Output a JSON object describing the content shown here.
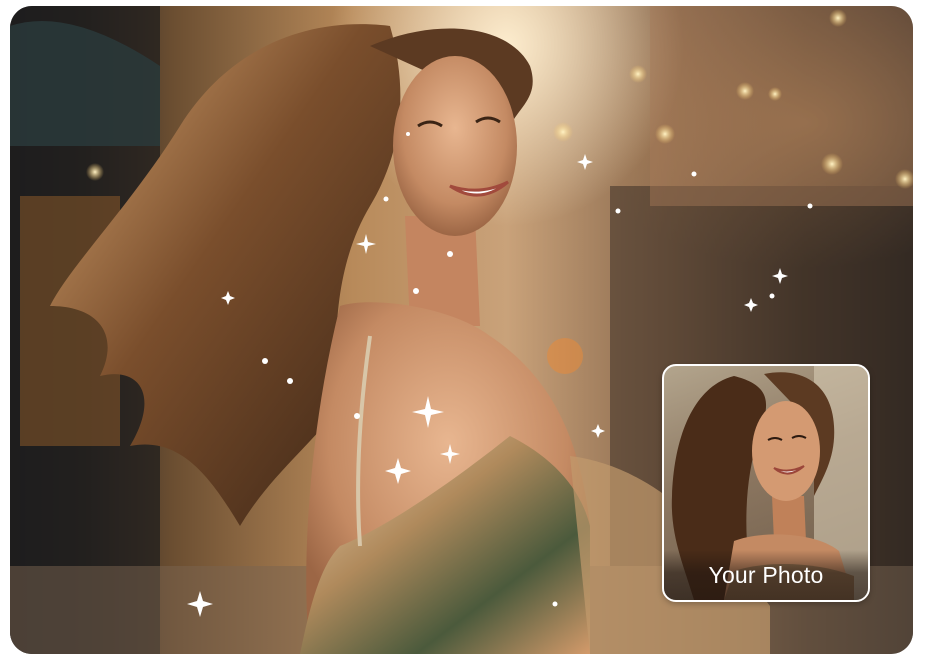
{
  "hero": {
    "image_name": "smiling-woman-sparkles-photo"
  },
  "thumbnail": {
    "caption": "Your Photo",
    "border_color": "#ffffff"
  },
  "colors": {
    "page_background": "#ffffff",
    "caption_text": "#ffffff"
  }
}
